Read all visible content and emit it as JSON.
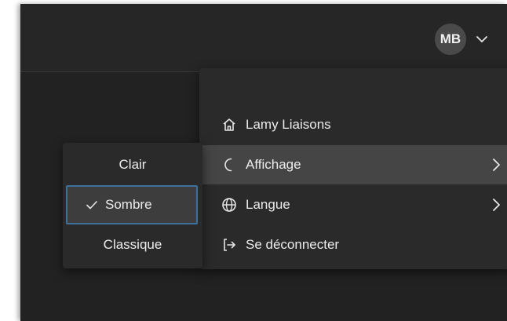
{
  "header": {
    "avatar_initials": "MB",
    "icons": {
      "dropdown": "chevron-down-icon"
    }
  },
  "user_menu": {
    "items": [
      {
        "label": "Lamy Liaisons",
        "icon": "home-icon"
      },
      {
        "label": "Affichage",
        "icon": "moon-icon",
        "active": true,
        "has_submenu": true
      },
      {
        "label": "Langue",
        "icon": "globe-icon",
        "has_submenu": true
      },
      {
        "label": "Se déconnecter",
        "icon": "logout-icon"
      }
    ]
  },
  "display_submenu": {
    "options": [
      "Clair",
      "Sombre",
      "Classique"
    ],
    "selected": "Sombre"
  },
  "colors": {
    "background": "#222222",
    "menu_bg": "#2a2a2a",
    "active_item_bg": "#454545",
    "selected_border": "#3f6f9c",
    "text": "#ececec"
  }
}
